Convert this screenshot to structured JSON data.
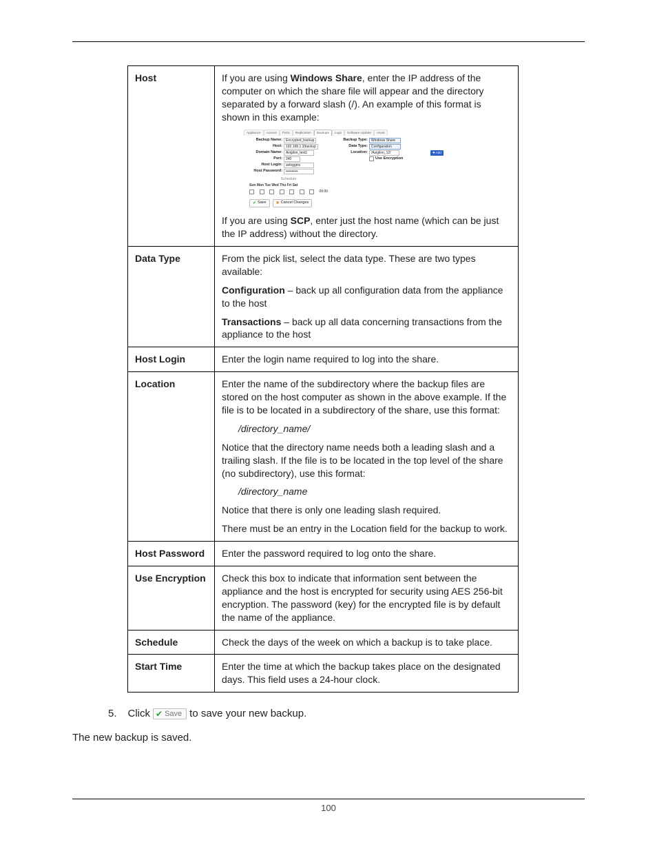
{
  "page_number": "100",
  "table": {
    "host": {
      "label": "Host",
      "p1_pre": "If you are using ",
      "p1_bold": "Windows Share",
      "p1_post": ", enter the IP address of the computer on which the share file will appear and the directory separated by a forward slash (/). An example of this format is shown in this example:",
      "p2_pre": "If you are using ",
      "p2_bold": "SCP",
      "p2_post": ", enter just the host name (which can be just the IP address) without the directory."
    },
    "data_type": {
      "label": "Data Type",
      "p1": "From the pick list, select the data type. These are two types available:",
      "p2_bold": "Configuration",
      "p2_rest": " – back up all configuration data from the appliance to the host",
      "p3_bold": "Transactions",
      "p3_rest": " – back up all data concerning transactions from the appliance to the host"
    },
    "host_login": {
      "label": "Host Login",
      "p1": "Enter the login name required to log into the share."
    },
    "location": {
      "label": "Location",
      "p1": "Enter the name of the subdirectory where the backup files are stored on the host computer as shown in the above example. If the file is to be located in a subdirectory of the share, use this format:",
      "f1": "/directory_name/",
      "p2": "Notice that the directory name needs both a leading slash and a trailing slash. If the file is to be located in the top level of the share (no subdirectory), use this format:",
      "f2": "/directory_name",
      "p3": "Notice that there is only one leading slash required.",
      "p4": "There must be an entry in the Location field for the backup to work."
    },
    "host_password": {
      "label": "Host Password",
      "p1": "Enter the password required to log onto the share."
    },
    "use_encryption": {
      "label": "Use Encryption",
      "p1": "Check this box to indicate that information sent between the appliance and the host is encrypted for security using AES 256-bit encryption. The password (key) for the encrypted file is by default the name of the appliance."
    },
    "schedule": {
      "label": "Schedule",
      "p1": "Check the days of the week on which a backup is to take place."
    },
    "start_time": {
      "label": "Start Time",
      "p1": "Enter the time at which the backup takes place on the designated days. This field uses a 24-hour clock."
    }
  },
  "mini_ui": {
    "tabs": [
      "Appliance",
      "Access",
      "Ports",
      "Replication",
      "Backups",
      "Logs",
      "Software Update",
      "Asset"
    ],
    "active_tab": "Backups",
    "left": {
      "backup_name_lbl": "Backup Name:",
      "backup_name": "Encrypted_backup",
      "host_lbl": "Host:",
      "host": "192.168.1.3/backup",
      "domain_lbl": "Domain Name:",
      "domain": "Avigilon_test1",
      "port_lbl": "Port:",
      "port": "240",
      "login_lbl": "Host Login:",
      "login": "avloggins",
      "pwd_lbl": "Host Password:",
      "pwd": "••••••••••"
    },
    "right": {
      "type_lbl": "Backup Type:",
      "type": "Windows Share",
      "data_lbl": "Data Type:",
      "data": "Configuration",
      "loc_lbl": "Location:",
      "loc": "/Avigilon_12/",
      "enc": "Use Encryption",
      "add": "✚ Add"
    },
    "schedule": {
      "title": "Schedule",
      "days": "Sun Mon Tue Wed Thu Fri Sat",
      "time": "09:00"
    },
    "buttons": {
      "save": "Save",
      "cancel": "Cancel Changes"
    }
  },
  "step": {
    "num": "5.",
    "pre": "Click ",
    "btn": "Save",
    "post": " to save your new backup."
  },
  "final": "The new backup is saved."
}
